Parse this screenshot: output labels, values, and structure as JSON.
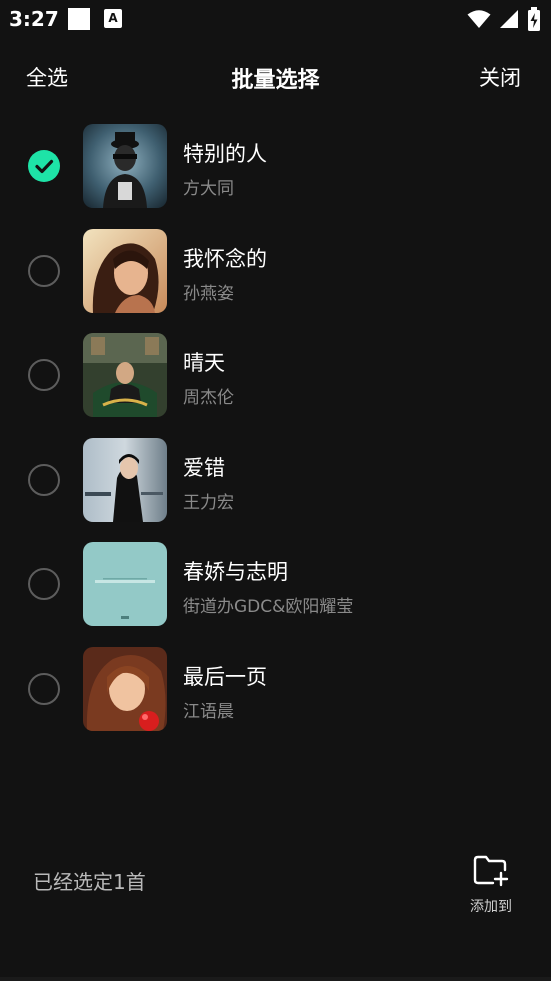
{
  "status_bar": {
    "time": "3:27",
    "icons": [
      "notification-square-icon",
      "text-a-icon",
      "wifi-icon",
      "signal-icon",
      "battery-charging-icon"
    ],
    "badge_letter": "A"
  },
  "header": {
    "select_all": "全选",
    "title": "批量选择",
    "close": "关闭"
  },
  "songs": [
    {
      "title": "特别的人",
      "artist": "方大同",
      "selected": true
    },
    {
      "title": "我怀念的",
      "artist": "孙燕姿",
      "selected": false
    },
    {
      "title": "晴天",
      "artist": "周杰伦",
      "selected": false
    },
    {
      "title": "爱错",
      "artist": "王力宏",
      "selected": false
    },
    {
      "title": "春娇与志明",
      "artist": "街道办GDC&欧阳耀莹",
      "selected": false
    },
    {
      "title": "最后一页",
      "artist": "江语晨",
      "selected": false
    }
  ],
  "footer": {
    "selected_count": "已经选定1首",
    "add_to": "添加到"
  },
  "colors": {
    "background": "#121212",
    "accent": "#1ee3a7",
    "secondary_text": "#8a8a8a"
  }
}
